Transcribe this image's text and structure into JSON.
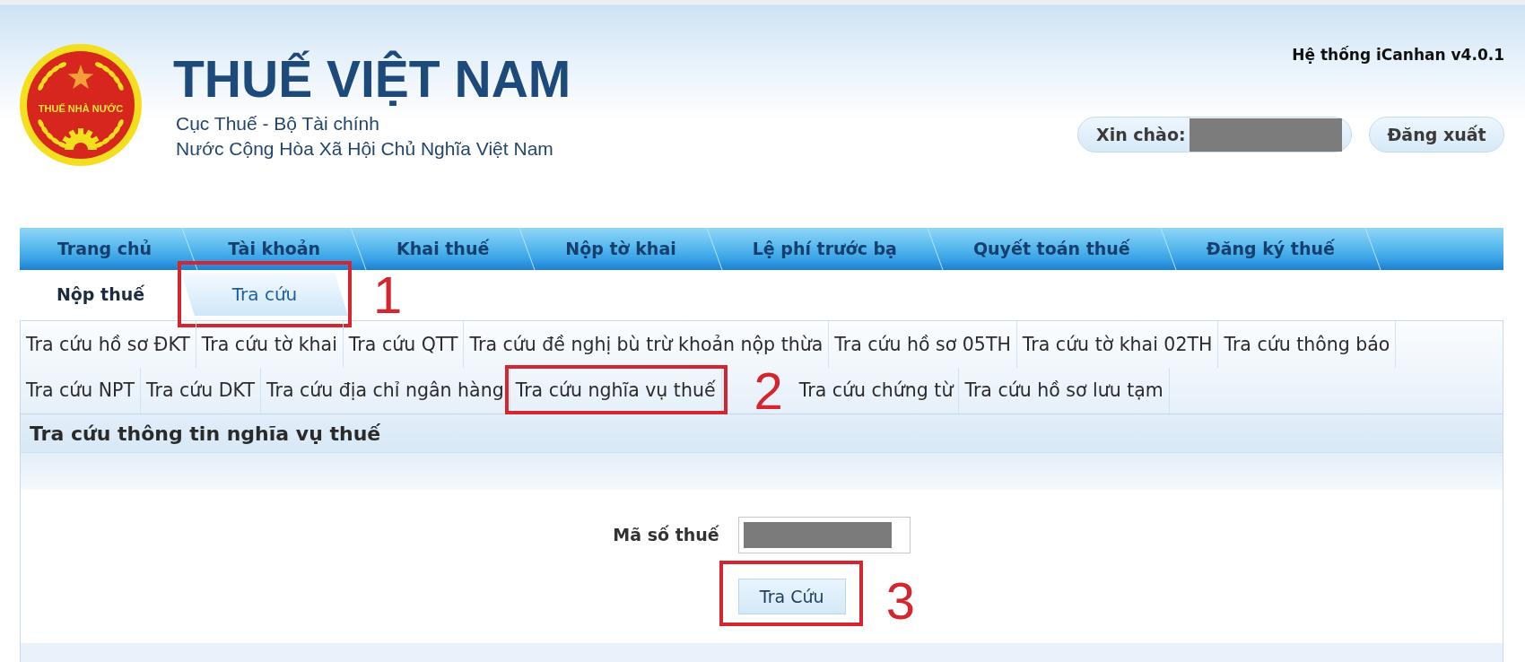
{
  "header": {
    "emblem_text": "THUẾ NHÀ NƯỚC",
    "title": "THUẾ VIỆT NAM",
    "subtitle_lines": [
      "Cục Thuế - Bộ Tài chính",
      "Nước Cộng Hòa Xã Hội Chủ Nghĩa Việt Nam"
    ],
    "system_version": "Hệ thống iCanhan v4.0.1",
    "greeting": {
      "label": "Xin chào:",
      "name_redacted": true
    },
    "logout_button": "Đăng xuất"
  },
  "main_menu": [
    "Trang chủ",
    "Tài khoản",
    "Khai thuế",
    "Nộp tờ khai",
    "Lệ phí trước bạ",
    "Quyết toán thuế",
    "Đăng ký thuế"
  ],
  "sub_tabs": [
    {
      "label": "Nộp thuế",
      "selected": false
    },
    {
      "label": "Tra cứu",
      "selected": true,
      "step_marker": "1"
    }
  ],
  "lookup_link_rows": [
    {
      "links": [
        {
          "label": "Tra cứu hồ sơ ĐKT"
        },
        {
          "label": "Tra cứu tờ khai"
        },
        {
          "label": "Tra cứu QTT"
        },
        {
          "label": "Tra cứu đề nghị bù trừ khoản nộp thừa"
        },
        {
          "label": "Tra cứu hồ sơ 05TH"
        },
        {
          "label": "Tra cứu tờ khai 02TH"
        },
        {
          "label": "Tra cứu thông báo"
        }
      ]
    },
    {
      "links": [
        {
          "label": "Tra cứu NPT"
        },
        {
          "label": "Tra cứu DKT"
        },
        {
          "label": "Tra cứu địa chỉ ngân hàng"
        },
        {
          "label": "Tra cứu nghĩa vụ thuế",
          "step_marker": "2"
        },
        {
          "label": "Tra cứu chứng từ"
        },
        {
          "label": "Tra cứu hồ sơ lưu tạm"
        }
      ]
    }
  ],
  "section": {
    "title": "Tra cứu thông tin nghĩa vụ thuế",
    "field": {
      "label": "Mã số thuế",
      "value_redacted": true
    },
    "submit_button": {
      "label": "Tra Cứu",
      "step_marker": "3"
    }
  }
}
